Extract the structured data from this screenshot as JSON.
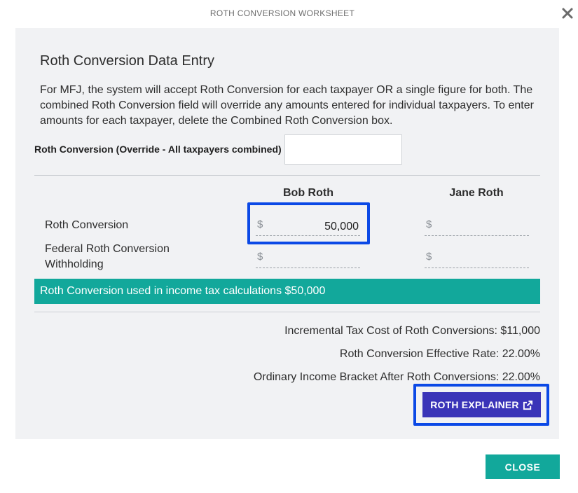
{
  "modal": {
    "title": "ROTH CONVERSION WORKSHEET",
    "close_icon": "close-x-icon"
  },
  "section": {
    "heading": "Roth Conversion Data Entry",
    "description": "For MFJ, the system will accept Roth Conversion for each taxpayer OR a single figure for both. The combined Roth Conversion field will override any amounts entered for individual taxpayers. To enter amounts for each taxpayer, delete the Combined Roth Conversion box."
  },
  "override": {
    "label": "Roth Conversion (Override - All taxpayers combined)",
    "value": ""
  },
  "columns": {
    "taxpayer1": "Bob Roth",
    "taxpayer2": "Jane Roth"
  },
  "rows": {
    "conversion": {
      "label": "Roth Conversion",
      "currency": "$",
      "taxpayer1_value": "50,000",
      "taxpayer2_value": ""
    },
    "withholding": {
      "label_line1": "Federal Roth Conversion",
      "label_line2": "Withholding",
      "currency": "$",
      "taxpayer1_value": "",
      "taxpayer2_value": ""
    }
  },
  "banner": {
    "text": "Roth Conversion used in income tax calculations $50,000"
  },
  "summary": {
    "incremental_cost": "Incremental Tax Cost of Roth Conversions:  $11,000",
    "effective_rate": "Roth Conversion Effective Rate:  22.00%",
    "bracket": "Ordinary Income Bracket After Roth Conversions:  22.00%"
  },
  "buttons": {
    "explainer_label": "ROTH EXPLAINER",
    "explainer_icon": "external-link-icon",
    "close_label": "CLOSE"
  },
  "colors": {
    "teal": "#12a89b",
    "explainer": "#3a34b8",
    "highlight": "#0b49e6",
    "panel": "#f1f2f4"
  }
}
